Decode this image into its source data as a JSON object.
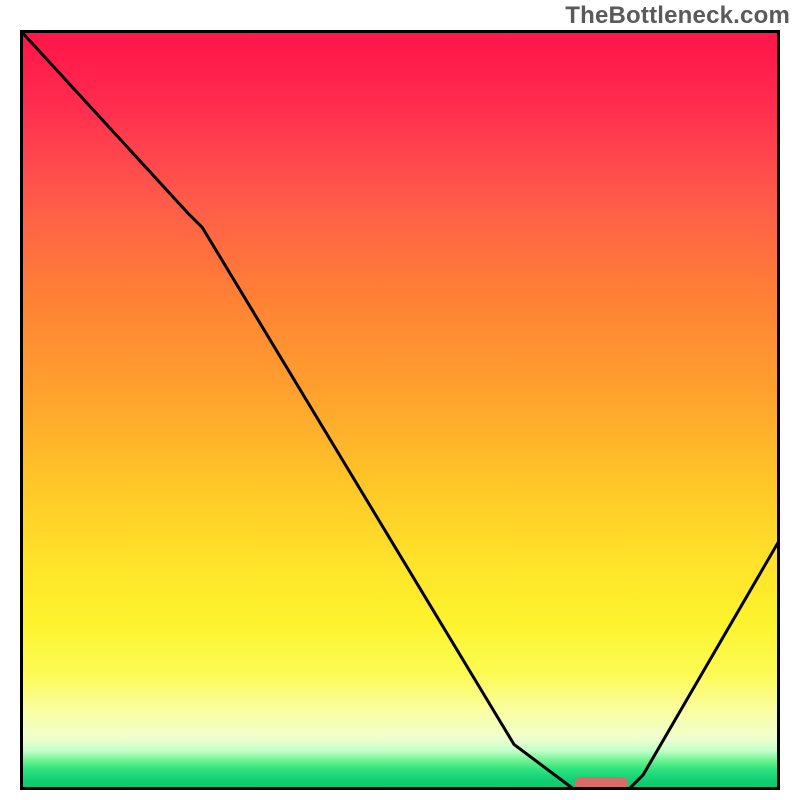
{
  "watermark": "TheBottleneck.com",
  "chart_data": {
    "type": "line",
    "title": "",
    "xlabel": "",
    "ylabel": "",
    "xlim": [
      0,
      100
    ],
    "ylim": [
      0,
      100
    ],
    "series": [
      {
        "name": "curve",
        "x": [
          0,
          22,
          24,
          65,
          73,
          80,
          82,
          100
        ],
        "values": [
          100,
          76,
          74,
          6,
          0,
          0,
          2,
          33
        ]
      }
    ],
    "marker": {
      "name": "minimum-marker",
      "x_start": 73,
      "x_end": 80,
      "y": 0,
      "color": "#db6b6b"
    },
    "gradient_bg": {
      "top": "#ff1749",
      "mid_upper": "#ffa22e",
      "mid_lower": "#fcfb55",
      "bottom": "#10c96f"
    }
  }
}
